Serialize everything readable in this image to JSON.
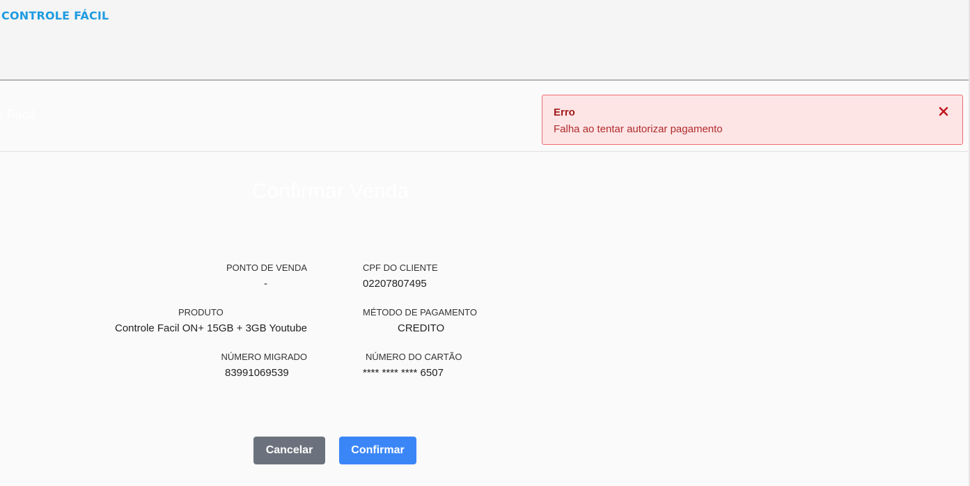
{
  "header": {
    "brand": "CONTROLE FÁCIL"
  },
  "subheader": {
    "ghost_brand": "e Fácil"
  },
  "toast": {
    "title": "Erro",
    "message": "Falha ao tentar autorizar pagamento",
    "close_icon": "close-x-icon",
    "color": "#a11a1a"
  },
  "page": {
    "title": "Confirmar Venda"
  },
  "summary": {
    "ponto_de_venda": {
      "label": "PONTO DE VENDA",
      "value": "-"
    },
    "cpf_cliente": {
      "label": "CPF DO CLIENTE",
      "value": "02207807495"
    },
    "produto": {
      "label": "PRODUTO",
      "value": "Controle Facil ON+ 15GB + 3GB Youtube"
    },
    "metodo_pagamento": {
      "label": "MÉTODO DE PAGAMENTO",
      "value": "CREDITO"
    },
    "numero_migrado": {
      "label": "NÚMERO MIGRADO",
      "value": "83991069539"
    },
    "numero_cartao": {
      "label": "NÚMERO DO CARTÃO",
      "value": "**** **** **** 6507"
    }
  },
  "actions": {
    "cancel_label": "Cancelar",
    "confirm_label": "Confirmar",
    "cancel_color": "#6c727d",
    "confirm_color": "#3b86f7"
  }
}
